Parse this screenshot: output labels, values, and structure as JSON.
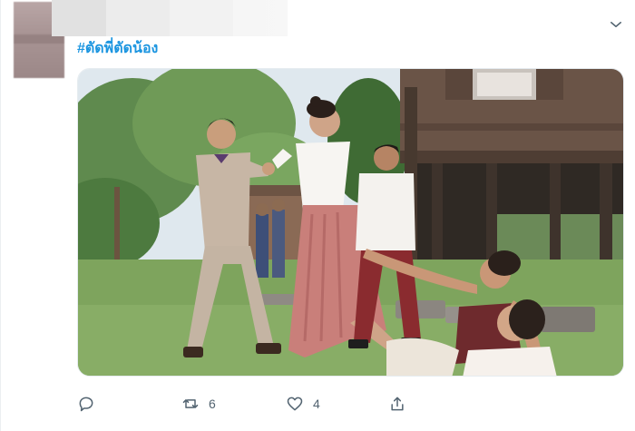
{
  "tweet": {
    "hashtag": "#ตัดพี่ตัดน้อง",
    "stats": {
      "replies": "",
      "retweets": "6",
      "likes": "4"
    }
  },
  "icons": {
    "menu": "chevron-down-icon",
    "reply": "reply-icon",
    "retweet": "retweet-icon",
    "like": "heart-icon",
    "share": "share-icon"
  },
  "colors": {
    "link": "#1b95e0",
    "icon": "#536471"
  }
}
